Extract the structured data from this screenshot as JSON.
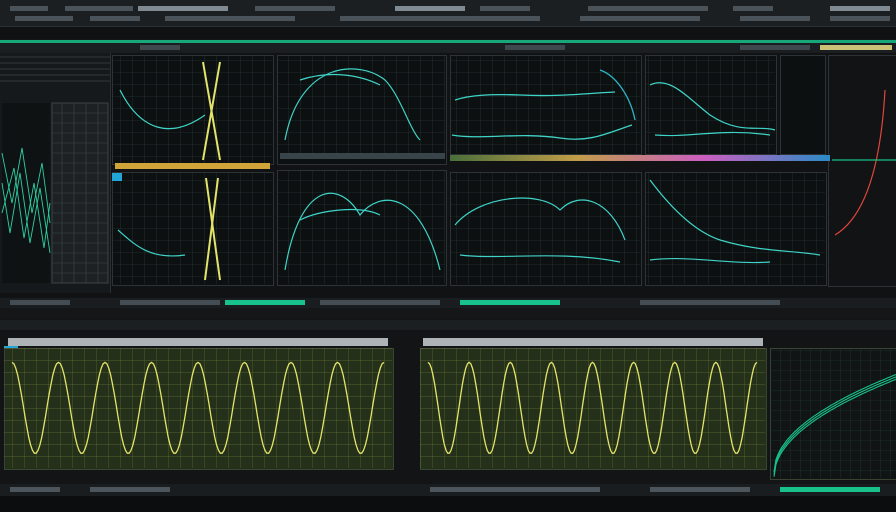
{
  "app": {
    "title": ""
  },
  "colors": {
    "accent_green": "#19c28a",
    "trace_cyan": "#3fd4c8",
    "trace_yellow": "#e3e46a",
    "trace_red": "#e0463c",
    "osc_background": "#25301a",
    "osc_grid": "#b7b94a",
    "chip_blue": "#22a6d6"
  },
  "icons": {
    "menu": "menu-strip-icon",
    "channel_chip": "channel-chip-icon"
  },
  "top_plots": [
    {
      "id": "plot-a1",
      "trace": "crossing-lines"
    },
    {
      "id": "plot-a2",
      "trace": "arch"
    },
    {
      "id": "plot-a3",
      "trace": "flat-waves"
    },
    {
      "id": "plot-a4",
      "trace": "rolling-wave"
    },
    {
      "id": "plot-b1",
      "trace": "crossing-lines"
    },
    {
      "id": "plot-b2",
      "trace": "bell"
    },
    {
      "id": "plot-b3",
      "trace": "arch"
    },
    {
      "id": "plot-b4",
      "trace": "rolling-wave"
    }
  ],
  "oscilloscopes": [
    {
      "id": "osc-1",
      "waveform": "sine",
      "cycles": 8
    },
    {
      "id": "osc-2",
      "waveform": "sine",
      "cycles": 8
    },
    {
      "id": "osc-3",
      "waveform": "rising-curve",
      "cycles": 1
    }
  ]
}
